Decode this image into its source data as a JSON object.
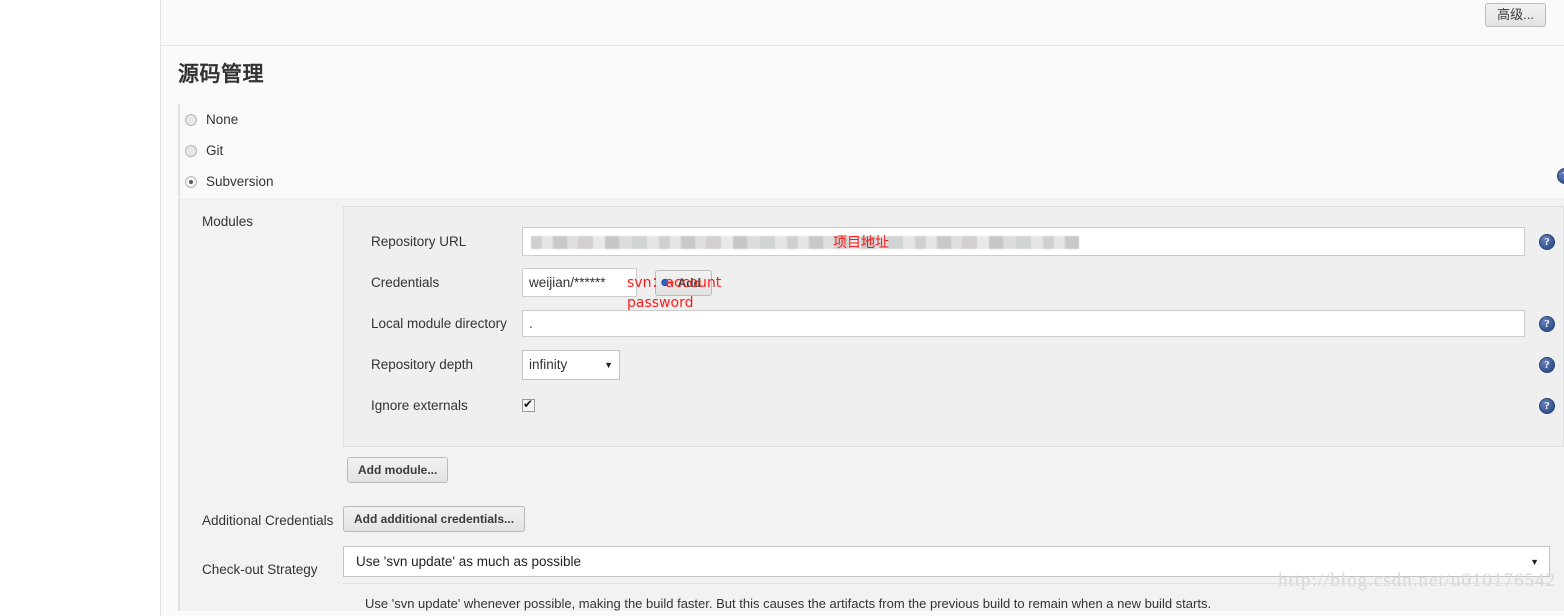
{
  "topbar": {
    "advanced_button": "高级..."
  },
  "section": {
    "title": "源码管理"
  },
  "scm_options": [
    {
      "label": "None",
      "selected": false
    },
    {
      "label": "Git",
      "selected": false
    },
    {
      "label": "Subversion",
      "selected": true
    }
  ],
  "properties": {
    "modules_label": "Modules",
    "additional_credentials_label": "Additional Credentials",
    "checkout_strategy_label": "Check-out Strategy"
  },
  "modules": {
    "repository_url": {
      "label": "Repository URL",
      "value": "",
      "masked": true
    },
    "credentials": {
      "label": "Credentials",
      "value": "weijian/******",
      "add_button": "Add"
    },
    "local_module_directory": {
      "label": "Local module directory",
      "value": "."
    },
    "repository_depth": {
      "label": "Repository depth",
      "value": "infinity",
      "caret": "▼"
    },
    "ignore_externals": {
      "label": "Ignore externals",
      "checked": true
    },
    "add_module_button": "Add module..."
  },
  "additional_credentials": {
    "button": "Add additional credentials..."
  },
  "checkout_strategy": {
    "value": "Use 'svn update' as much as possible",
    "caret": "▼",
    "description": "Use 'svn update' whenever possible, making the build faster. But this causes the artifacts from the previous build to remain when a new build starts."
  },
  "annotations": {
    "repo_url": "项目地址",
    "credentials_line1": "svn：account",
    "credentials_line2": "password"
  },
  "help_icon_glyph": "?",
  "watermark": "http://blog.csdn.net/u010176542",
  "colors": {
    "annotation_red": "#ff1a1a",
    "help_blue": "#3b5998",
    "panel_gray": "#f2f2f2"
  }
}
